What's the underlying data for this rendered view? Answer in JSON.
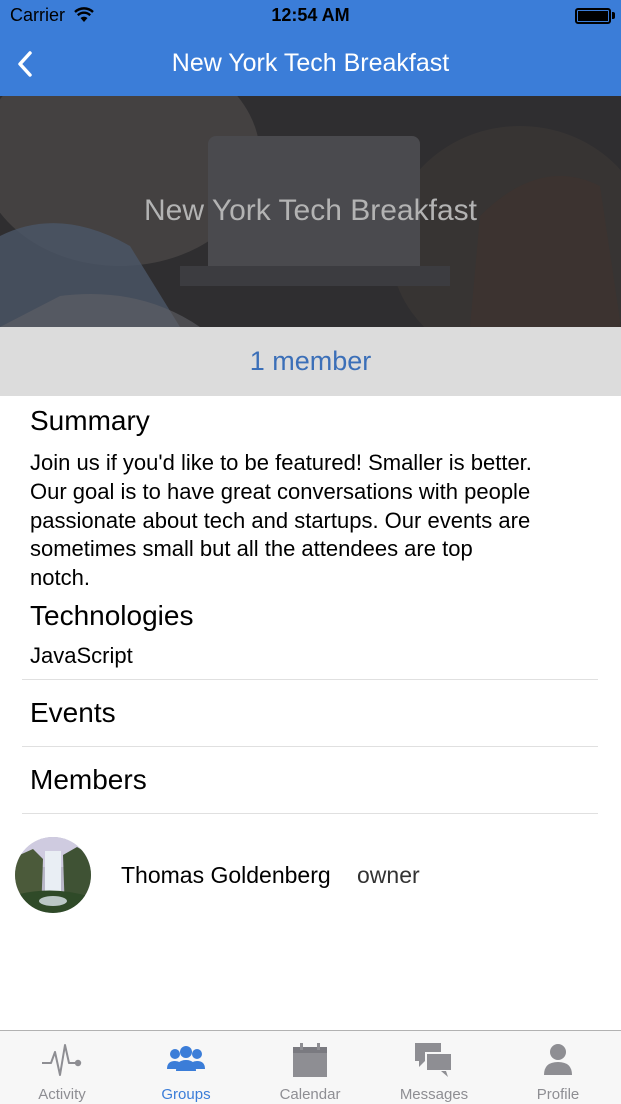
{
  "status_bar": {
    "carrier": "Carrier",
    "time": "12:54 AM"
  },
  "nav": {
    "title": "New York Tech Breakfast",
    "back_icon": "chevron-left-icon"
  },
  "hero": {
    "title": "New York Tech Breakfast"
  },
  "members_bar": {
    "count_label": "1 member"
  },
  "summary": {
    "heading": "Summary",
    "lines": [
      "Join us if you'd like to be featured! Smaller is better.",
      "Our goal is to have great conversations with people",
      "passionate about tech and startups. Our events are",
      "sometimes small but all the attendees are top",
      "notch."
    ]
  },
  "technologies": {
    "heading": "Technologies",
    "items": [
      "JavaScript"
    ]
  },
  "events": {
    "heading": "Events"
  },
  "members": {
    "heading": "Members",
    "list": [
      {
        "name": "Thomas Goldenberg",
        "role": "owner"
      }
    ]
  },
  "tab_bar": {
    "active_color": "#3b7dd8",
    "inactive_color": "#8e8e93",
    "tabs": [
      {
        "label": "Activity",
        "icon": "activity-pulse-icon",
        "active": false
      },
      {
        "label": "Groups",
        "icon": "groups-icon",
        "active": true
      },
      {
        "label": "Calendar",
        "icon": "calendar-icon",
        "active": false
      },
      {
        "label": "Messages",
        "icon": "messages-icon",
        "active": false
      },
      {
        "label": "Profile",
        "icon": "profile-icon",
        "active": false
      }
    ]
  },
  "colors": {
    "nav_blue": "#3b7dd8",
    "link_blue": "#3b6fb8"
  }
}
